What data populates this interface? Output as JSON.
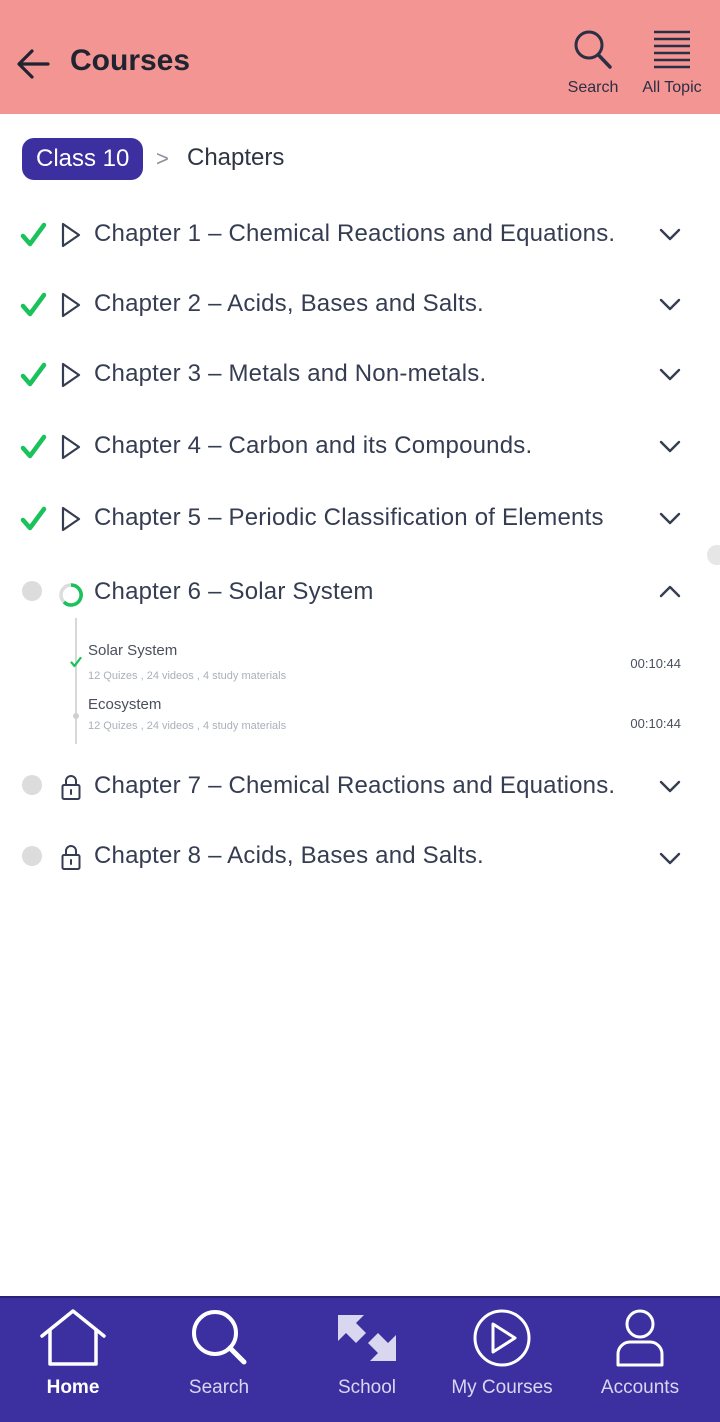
{
  "header": {
    "title": "Courses",
    "search_label": "Search",
    "all_topic_label": "All Topic"
  },
  "breadcrumb": {
    "class_label": "Class 10",
    "separator": ">",
    "current": "Chapters"
  },
  "chapters": [
    {
      "title": "Chapter 1 – Chemical Reactions and Equations.",
      "status": "completed",
      "expanded": false
    },
    {
      "title": "Chapter 2 – Acids, Bases and Salts.",
      "status": "completed",
      "expanded": false
    },
    {
      "title": "Chapter 3 – Metals and Non-metals.",
      "status": "completed",
      "expanded": false
    },
    {
      "title": "Chapter 4 – Carbon and its Compounds.",
      "status": "completed",
      "expanded": false
    },
    {
      "title": "Chapter 5 – Periodic Classification of Elements",
      "status": "completed",
      "expanded": false
    },
    {
      "title": "Chapter 6 – Solar System",
      "status": "in-progress",
      "expanded": true,
      "topics": [
        {
          "title": "Solar System",
          "meta": "12 Quizes ,  24 videos , 4 study materials",
          "time": "00:10:44",
          "done": true
        },
        {
          "title": "Ecosystem",
          "meta": "12 Quizes ,  24 videos , 4 study materials",
          "time": "00:10:44",
          "done": false
        }
      ]
    },
    {
      "title": "Chapter 7 – Chemical Reactions and Equations.",
      "status": "locked",
      "expanded": false
    },
    {
      "title": "Chapter 8 – Acids, Bases and Salts.",
      "status": "locked",
      "expanded": false
    }
  ],
  "tabbar": {
    "home": "Home",
    "search": "Search",
    "school": "School",
    "my_courses": "My Courses",
    "accounts": "Accounts"
  },
  "colors": {
    "header_bg": "#f39592",
    "accent": "#3c2fa0",
    "success": "#19c25a"
  }
}
